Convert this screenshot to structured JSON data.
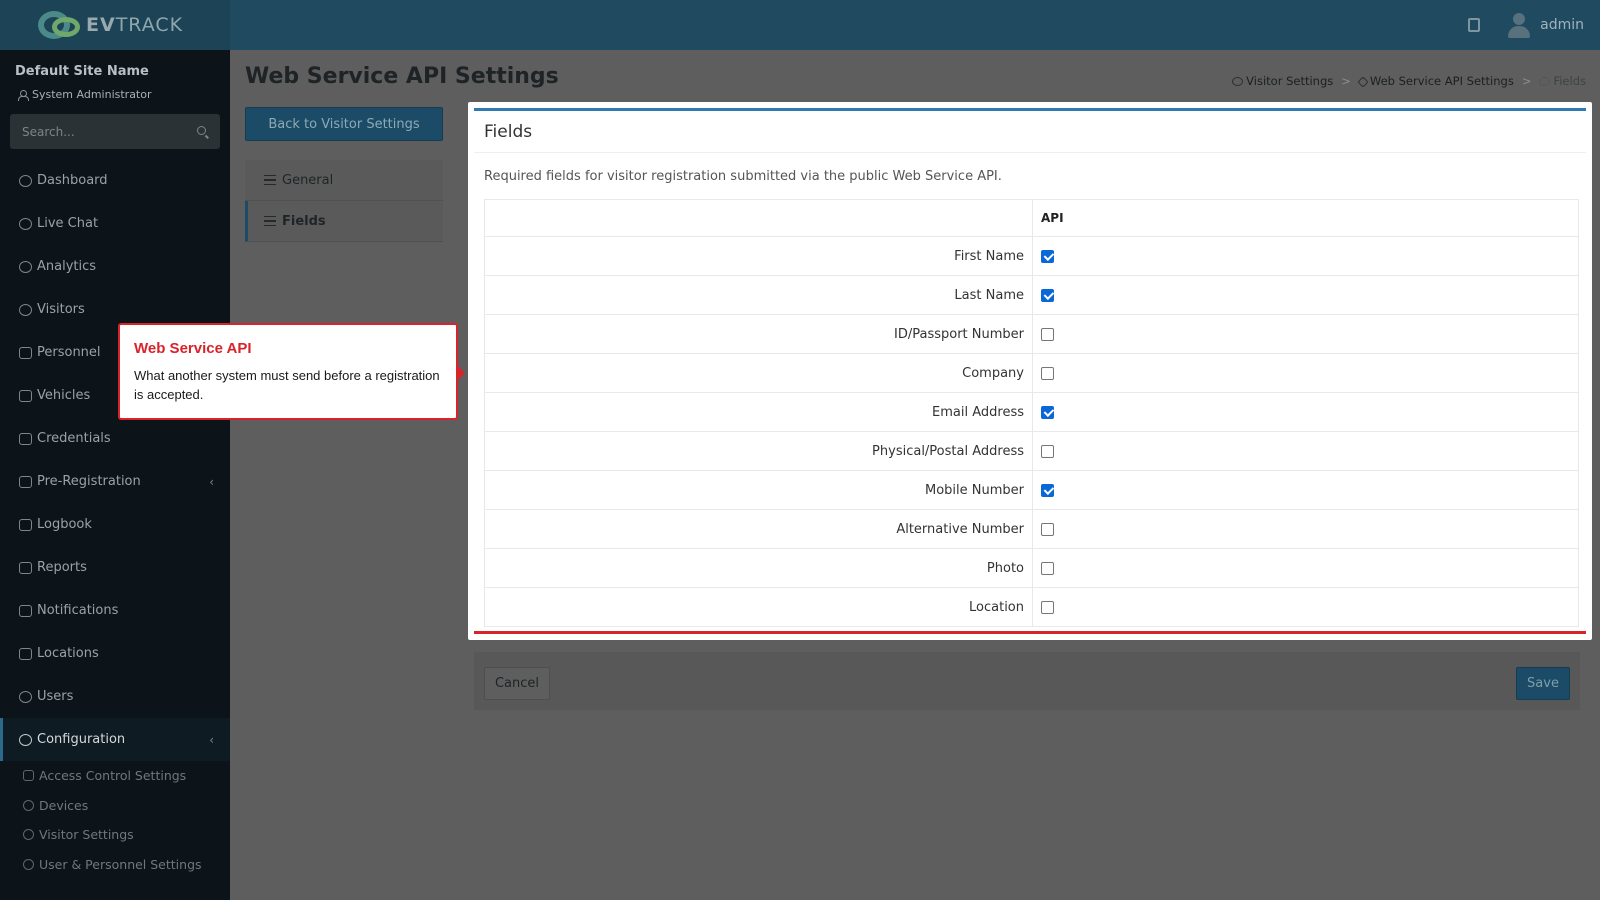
{
  "brand": {
    "logo_text_bold": "EV",
    "logo_text_light": "TRACK"
  },
  "header": {
    "user_name": "admin"
  },
  "sidebar": {
    "site_name": "Default Site Name",
    "role": "System Administrator",
    "search_placeholder": "Search...",
    "items": [
      {
        "label": "Dashboard",
        "icon": "dashboard-icon"
      },
      {
        "label": "Live Chat",
        "icon": "headset-icon"
      },
      {
        "label": "Analytics",
        "icon": "target-icon"
      },
      {
        "label": "Visitors",
        "icon": "eye-icon"
      },
      {
        "label": "Personnel",
        "icon": "user-tie-icon"
      },
      {
        "label": "Vehicles",
        "icon": "car-icon"
      },
      {
        "label": "Credentials",
        "icon": "id-card-icon"
      },
      {
        "label": "Pre-Registration",
        "icon": "arrows-icon",
        "expandable": true
      },
      {
        "label": "Logbook",
        "icon": "book-icon"
      },
      {
        "label": "Reports",
        "icon": "chart-icon"
      },
      {
        "label": "Notifications",
        "icon": "comment-icon"
      },
      {
        "label": "Locations",
        "icon": "building-icon"
      },
      {
        "label": "Users",
        "icon": "users-icon"
      },
      {
        "label": "Configuration",
        "icon": "gear-icon",
        "expandable": true,
        "active": true
      }
    ],
    "sub_items": [
      {
        "label": "Access Control Settings",
        "icon": "lock-icon"
      },
      {
        "label": "Devices",
        "icon": "gear-icon"
      },
      {
        "label": "Visitor Settings",
        "icon": "eye-icon"
      },
      {
        "label": "User & Personnel Settings",
        "icon": "users-icon"
      }
    ]
  },
  "page": {
    "title": "Web Service API Settings",
    "breadcrumb": [
      "Visitor Settings",
      "Web Service API Settings",
      "Fields"
    ],
    "back_button": "Back to Visitor Settings",
    "tabs": [
      {
        "label": "General",
        "active": false
      },
      {
        "label": "Fields",
        "active": true
      }
    ]
  },
  "card": {
    "title": "Fields",
    "description": "Required fields for visitor registration submitted via the public Web Service API.",
    "column_header": "API",
    "fields": [
      {
        "label": "First Name",
        "checked": true
      },
      {
        "label": "Last Name",
        "checked": true
      },
      {
        "label": "ID/Passport Number",
        "checked": false
      },
      {
        "label": "Company",
        "checked": false
      },
      {
        "label": "Email Address",
        "checked": true
      },
      {
        "label": "Physical/Postal Address",
        "checked": false
      },
      {
        "label": "Mobile Number",
        "checked": true
      },
      {
        "label": "Alternative Number",
        "checked": false
      },
      {
        "label": "Photo",
        "checked": false
      },
      {
        "label": "Location",
        "checked": false
      }
    ]
  },
  "footer": {
    "cancel_label": "Cancel",
    "save_label": "Save"
  },
  "callout": {
    "title": "Web Service API",
    "body": "What another system must send before a registration is accepted."
  },
  "colors": {
    "highlight": "#d9232b",
    "accent": "#2f7ab3",
    "primary_button": "#1b4b66",
    "checkbox": "#0a67d8"
  }
}
